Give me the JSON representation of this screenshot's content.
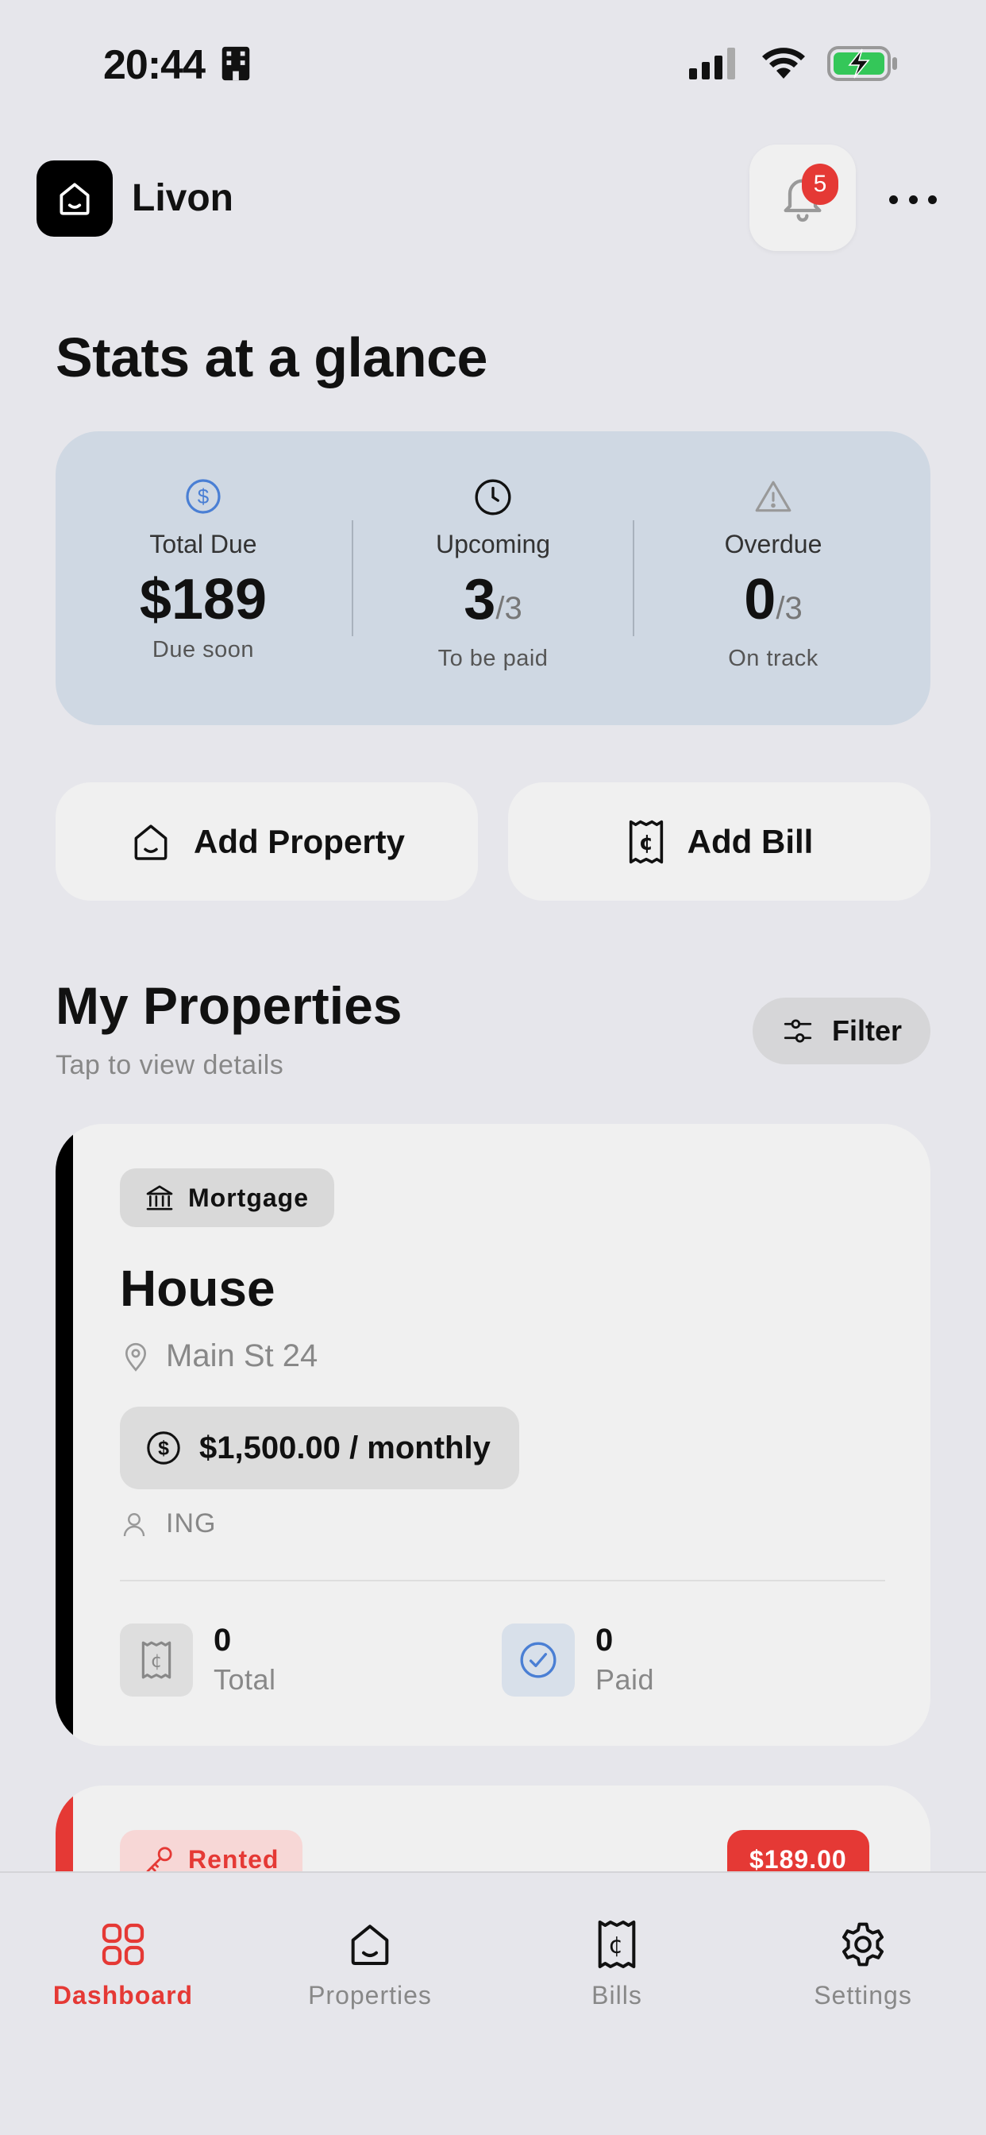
{
  "status_bar": {
    "time": "20:44"
  },
  "header": {
    "app_name": "Livon",
    "notification_count": "5"
  },
  "stats": {
    "title": "Stats at a glance",
    "total_due": {
      "label": "Total Due",
      "value": "$189",
      "sub": "Due soon"
    },
    "upcoming": {
      "label": "Upcoming",
      "value": "3",
      "denominator": "/3",
      "sub": "To be paid"
    },
    "overdue": {
      "label": "Overdue",
      "value": "0",
      "denominator": "/3",
      "sub": "On track"
    }
  },
  "actions": {
    "add_property": "Add Property",
    "add_bill": "Add Bill"
  },
  "properties": {
    "title": "My Properties",
    "subtitle": "Tap to view details",
    "filter_label": "Filter",
    "items": [
      {
        "type": "Mortgage",
        "name": "House",
        "address": "Main St 24",
        "amount": "$1,500.00 / monthly",
        "lender": "ING",
        "total_count": "0",
        "total_label": "Total",
        "paid_count": "0",
        "paid_label": "Paid",
        "accent": "#000000"
      },
      {
        "type": "Rented",
        "amount_badge": "$189.00",
        "accent": "#e53935"
      }
    ]
  },
  "tabbar": {
    "items": [
      {
        "label": "Dashboard",
        "icon": "grid-icon",
        "active": true
      },
      {
        "label": "Properties",
        "icon": "home-icon",
        "active": false
      },
      {
        "label": "Bills",
        "icon": "receipt-icon",
        "active": false
      },
      {
        "label": "Settings",
        "icon": "gear-icon",
        "active": false
      }
    ]
  },
  "colors": {
    "accent": "#e53935",
    "stats_bg": "#cfd8e3",
    "background": "#e6e6eb"
  }
}
